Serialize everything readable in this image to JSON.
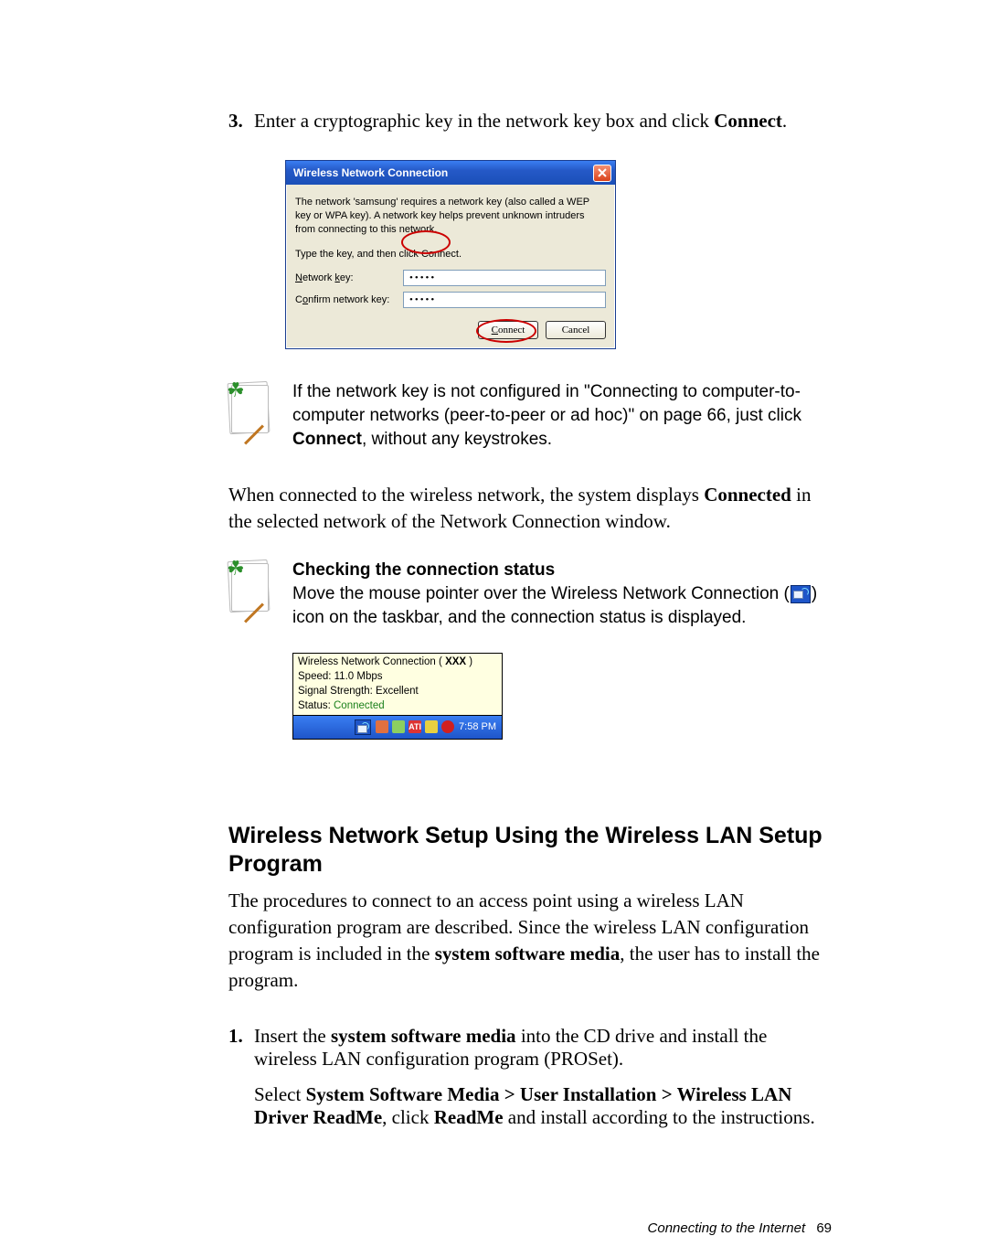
{
  "step3": {
    "num": "3.",
    "text_a": "Enter a cryptographic key in the network key box and click ",
    "bold_a": "Connect",
    "text_b": "."
  },
  "dialog": {
    "title": "Wireless Network Connection",
    "help": "The network 'samsung' requires a network key (also called a WEP key or WPA key). A network key helps prevent unknown intruders from connecting to this network.",
    "instruction": "Type the key, and then click Connect.",
    "label_key": "Network key:",
    "label_confirm": "Confirm network key:",
    "value_key": "•••••",
    "value_confirm": "•••••",
    "btn_connect": "Connect",
    "btn_cancel": "Cancel"
  },
  "note1": {
    "a": "If the network key is not configured in \"Connecting to computer-to-computer networks (peer-to-peer or ad hoc)\" on page 66, just click ",
    "b": "Connect",
    "c": ", without any keystrokes."
  },
  "para1": {
    "a": "When connected to the wireless network, the system displays ",
    "b": "Connected",
    "c": " in the selected network of the Network Connection window."
  },
  "note2": {
    "heading": "Checking the connection status",
    "a": "Move the mouse pointer over the Wireless Network Connection (",
    "b": ") icon on the taskbar, and the connection status is displayed."
  },
  "tooltip": {
    "l1a": "Wireless Network Connection ( ",
    "l1b": "XXX",
    "l1c": " )",
    "l2": "Speed: 11.0 Mbps",
    "l3": "Signal Strength: Excellent",
    "l4a": "Status: ",
    "l4b": "Connected",
    "time": "7:58 PM"
  },
  "h2": "Wireless Network Setup Using the Wireless LAN Setup Program",
  "para2": {
    "a": "The procedures to connect to an access point using a wireless LAN configuration program are described. Since the wireless LAN configuration program is included in the ",
    "b": "system software media",
    "c": ", the user has to install the program."
  },
  "step1": {
    "num": "1.",
    "a": "Insert the ",
    "b": "system software media",
    "c": " into the CD drive and install the wireless LAN configuration program (PROSet).",
    "d": "Select ",
    "e": "System Software Media > User Installation > Wireless LAN Driver ReadMe",
    "f": ", click ",
    "g": "ReadMe",
    "h": " and install according to the instructions."
  },
  "footer": {
    "title": "Connecting to the Internet",
    "page": "69"
  }
}
